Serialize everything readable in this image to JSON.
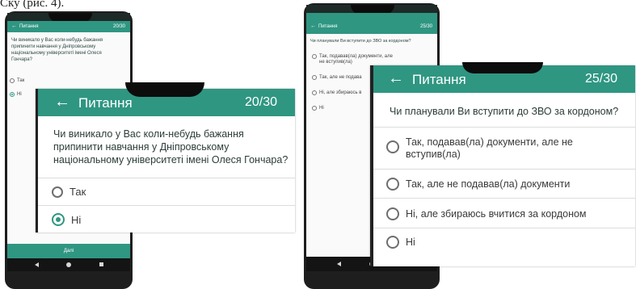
{
  "page_top_text": "Ску (рис. 4).",
  "left_phone": {
    "title": "Питання",
    "counter": "20/30",
    "question": "Чи виникало у Вас коли-небудь бажання припинити навчання у Дніпровському національному університеті імені Олеся Гончара?",
    "options": [
      {
        "label": "Так",
        "selected": false
      },
      {
        "label": "Ні",
        "selected": true
      }
    ],
    "next_button": "Далі"
  },
  "left_zoom": {
    "title": "Питання",
    "counter": "20/30",
    "question_lines": [
      "Чи виникало у Вас коли-небудь бажання",
      "припинити навчання у Дніпровському",
      "національному університеті імені Олеся Гончара?"
    ],
    "options": [
      {
        "label": "Так",
        "selected": false
      },
      {
        "label": "Ні",
        "selected": true
      }
    ]
  },
  "right_phone": {
    "title": "Питання",
    "counter": "25/30",
    "question": "Чи планували Ви вступити до ЗВО за кордоном?",
    "options": [
      {
        "label": "Так, подавав(ла) документи, але не вступив(ла)",
        "selected": false
      },
      {
        "label": "Так, але не подава",
        "selected": false
      },
      {
        "label": "Ні, але збираюсь в",
        "selected": false
      },
      {
        "label": "Ні",
        "selected": false
      }
    ]
  },
  "right_zoom": {
    "title": "Питання",
    "counter": "25/30",
    "question": "Чи планували Ви вступити до ЗВО за кордоном?",
    "options": [
      {
        "line1": "Так, подавав(ла) документи, але не",
        "line2": "вступив(ла)",
        "selected": false
      },
      {
        "line1": "Так, але не подавав(ла) документи",
        "line2": "",
        "selected": false
      },
      {
        "line1": "Ні, але збираюсь вчитися за кордоном",
        "line2": "",
        "selected": false
      },
      {
        "line1": "Ні",
        "line2": "",
        "selected": false
      }
    ]
  },
  "colors": {
    "accent": "#2f9682",
    "phone_body": "#1e1e1e"
  }
}
